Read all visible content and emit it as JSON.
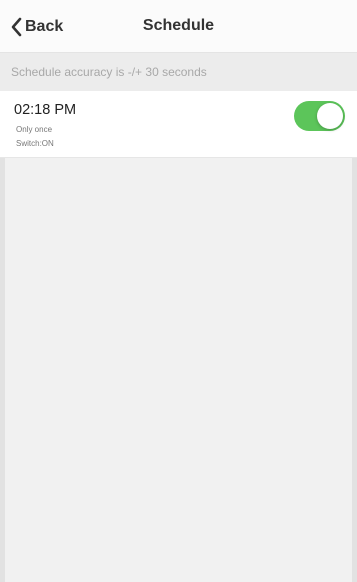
{
  "nav": {
    "back_label": "Back",
    "title": "Schedule"
  },
  "info": {
    "text": "Schedule accuracy is -/+ 30 seconds"
  },
  "schedules": [
    {
      "time": "02:18 PM",
      "repeat": "Only once",
      "action": "Switch:ON",
      "enabled": true
    }
  ],
  "colors": {
    "toggle_on": "#5cc55a",
    "header_bg": "#fbfbfb",
    "info_bg": "#ececec",
    "page_bg": "#f1f1f1"
  },
  "icons": {
    "back": "chevron-left-icon"
  }
}
